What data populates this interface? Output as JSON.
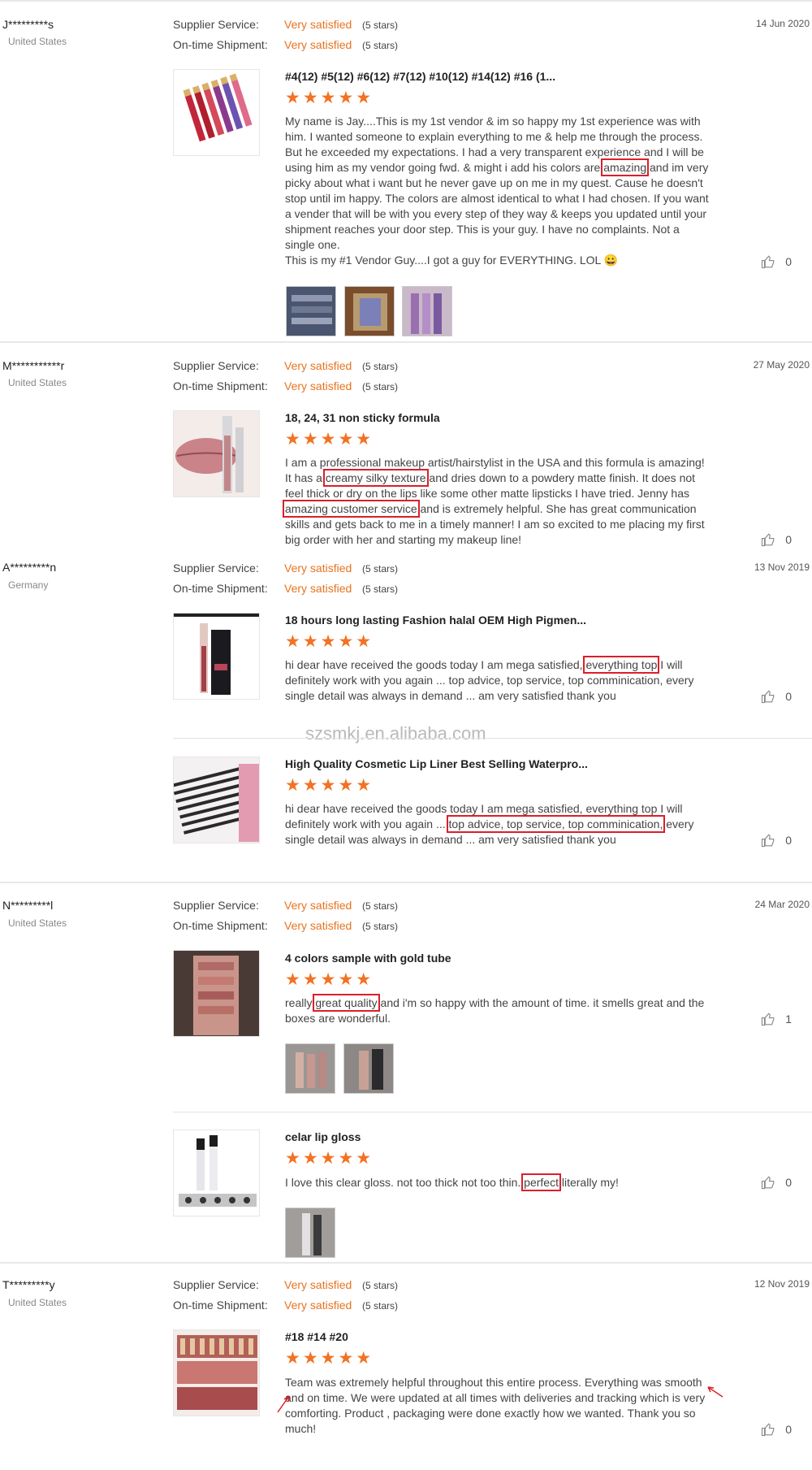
{
  "labels": {
    "supplier_service": "Supplier Service:",
    "ontime_shipment": "On-time Shipment:",
    "rating_value": "Very satisfied",
    "rating_stars": "(5 stars)",
    "star_row": "★★★★★"
  },
  "watermark": "szsmkj.en.alibaba.com",
  "reviews": [
    {
      "buyer": "J*********s",
      "country": "United States",
      "date": "14 Jun 2020",
      "items": [
        {
          "title": "#4(12) #5(12) #6(12) #7(12) #10(12) #14(12) #16 (1...",
          "review_before": "My name is Jay....This is my 1st vendor & im so happy my 1st experience was with him. I wanted someone to explain everything to me & help me through the process. But he exceeded my expectations. I had a very transparent experience and I will be using him as my vendor going fwd. & might i add his colors are ",
          "review_highlight": "amazing",
          "review_after": " and im very picky about what i want but he never gave up on me in my quest. Cause he doesn't stop until im happy. The colors are almost identical to what I had chosen. If you want a vender that will be with you every step of they way & keeps you updated until your shipment reaches your door step. This is your guy. I have no complaints. Not a single one.",
          "review_last": "This is my #1 Vendor Guy....I got a guy for EVERYTHING. LOL 😀",
          "likes": "0"
        }
      ]
    },
    {
      "buyer": "M***********r",
      "country": "United States",
      "date": "27 May 2020",
      "items": [
        {
          "title": "18, 24, 31 non sticky formula",
          "review_a": "I am a professional makeup artist/hairstylist in the USA and this formula is amazing! It has a ",
          "review_h1": "creamy silky texture",
          "review_b": " and dries down to a powdery matte finish. It does not feel thick or dry on the lips like some other matte lipsticks I have tried. Jenny has ",
          "review_h2": "amazing customer service",
          "review_c": " and is extremely helpful. She has great communication skills and gets back to me in a timely manner! I am so excited to me placing my first big order with her and starting my makeup line!",
          "likes": "0"
        }
      ]
    },
    {
      "buyer": "A*********n",
      "country": "Germany",
      "date": "13 Nov 2019",
      "items": [
        {
          "title": "18 hours long lasting Fashion halal OEM High Pigmen...",
          "review_a": "hi dear have received the goods today I am mega satisfied, ",
          "review_h1": "everything top",
          "review_b": " I will definitely work with you again ... top advice, top service, top comminication, every single detail was always in demand ... am very satisfied thank you",
          "likes": "0"
        },
        {
          "title": "High Quality Cosmetic Lip Liner Best Selling Waterpro...",
          "review_a": "hi dear have received the goods today I am mega satisfied, everything top I will definitely work with you again ... ",
          "review_h1": "top advice, top service, top comminication,",
          "review_b": " every single detail was always in demand ... am very satisfied thank you",
          "likes": "0"
        }
      ]
    },
    {
      "buyer": "N*********l",
      "country": "United States",
      "date": "24 Mar 2020",
      "items": [
        {
          "title": "4 colors sample with gold tube",
          "review_a": "really ",
          "review_h1": "great quality",
          "review_b": " and i'm so happy with the amount of time. it smells great and the boxes are wonderful.",
          "likes": "1"
        },
        {
          "title": "celar lip gloss",
          "review_a": "I love this clear gloss. not too thick not too thin. ",
          "review_h1": "perfect",
          "review_b": " literally my!",
          "likes": "0"
        }
      ]
    },
    {
      "buyer": "T*********y",
      "country": "United States",
      "date": "12 Nov 2019",
      "items": [
        {
          "title": "#18 #14 #20",
          "review": "Team was extremely helpful throughout this entire process. Everything was smooth and on time. We were updated at all times with deliveries and tracking which is very comforting. Product , packaging were done exactly how we wanted. Thank you so much!",
          "likes": "0"
        }
      ]
    }
  ]
}
